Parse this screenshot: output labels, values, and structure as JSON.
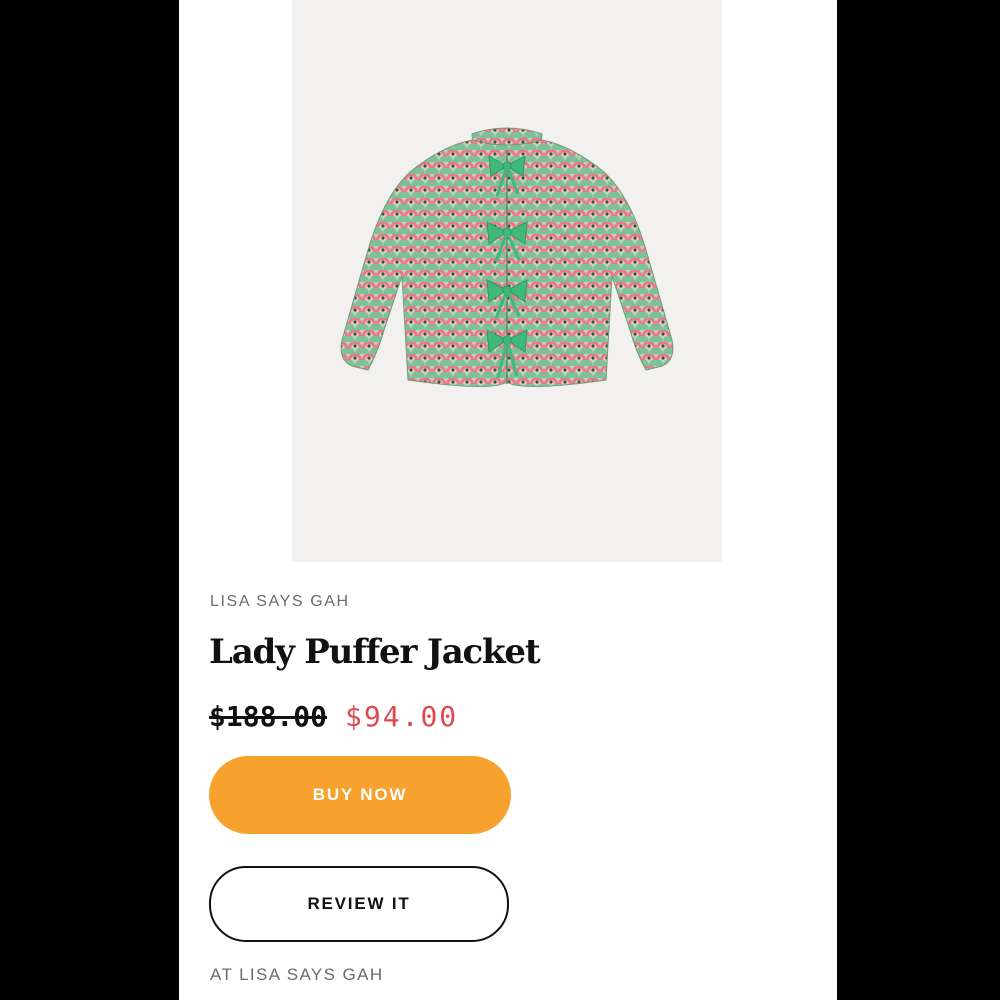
{
  "product": {
    "brand": "LISA SAYS GAH",
    "title": "Lady Puffer Jacket",
    "original_price": "$188.00",
    "sale_price": "$94.00",
    "image_icon": "jacket-image"
  },
  "actions": {
    "buy_label": "BUY NOW",
    "review_label": "REVIEW IT"
  },
  "footer": {
    "store_label": "AT LISA SAYS GAH"
  },
  "colors": {
    "background": "#000000",
    "panel": "#ffffff",
    "sale_price": "#e0484e",
    "buy_button": "#f7a22e",
    "jacket_base": "#9fc9a9",
    "jacket_pattern_pink": "#e57a86",
    "jacket_ties": "#3fb878"
  }
}
